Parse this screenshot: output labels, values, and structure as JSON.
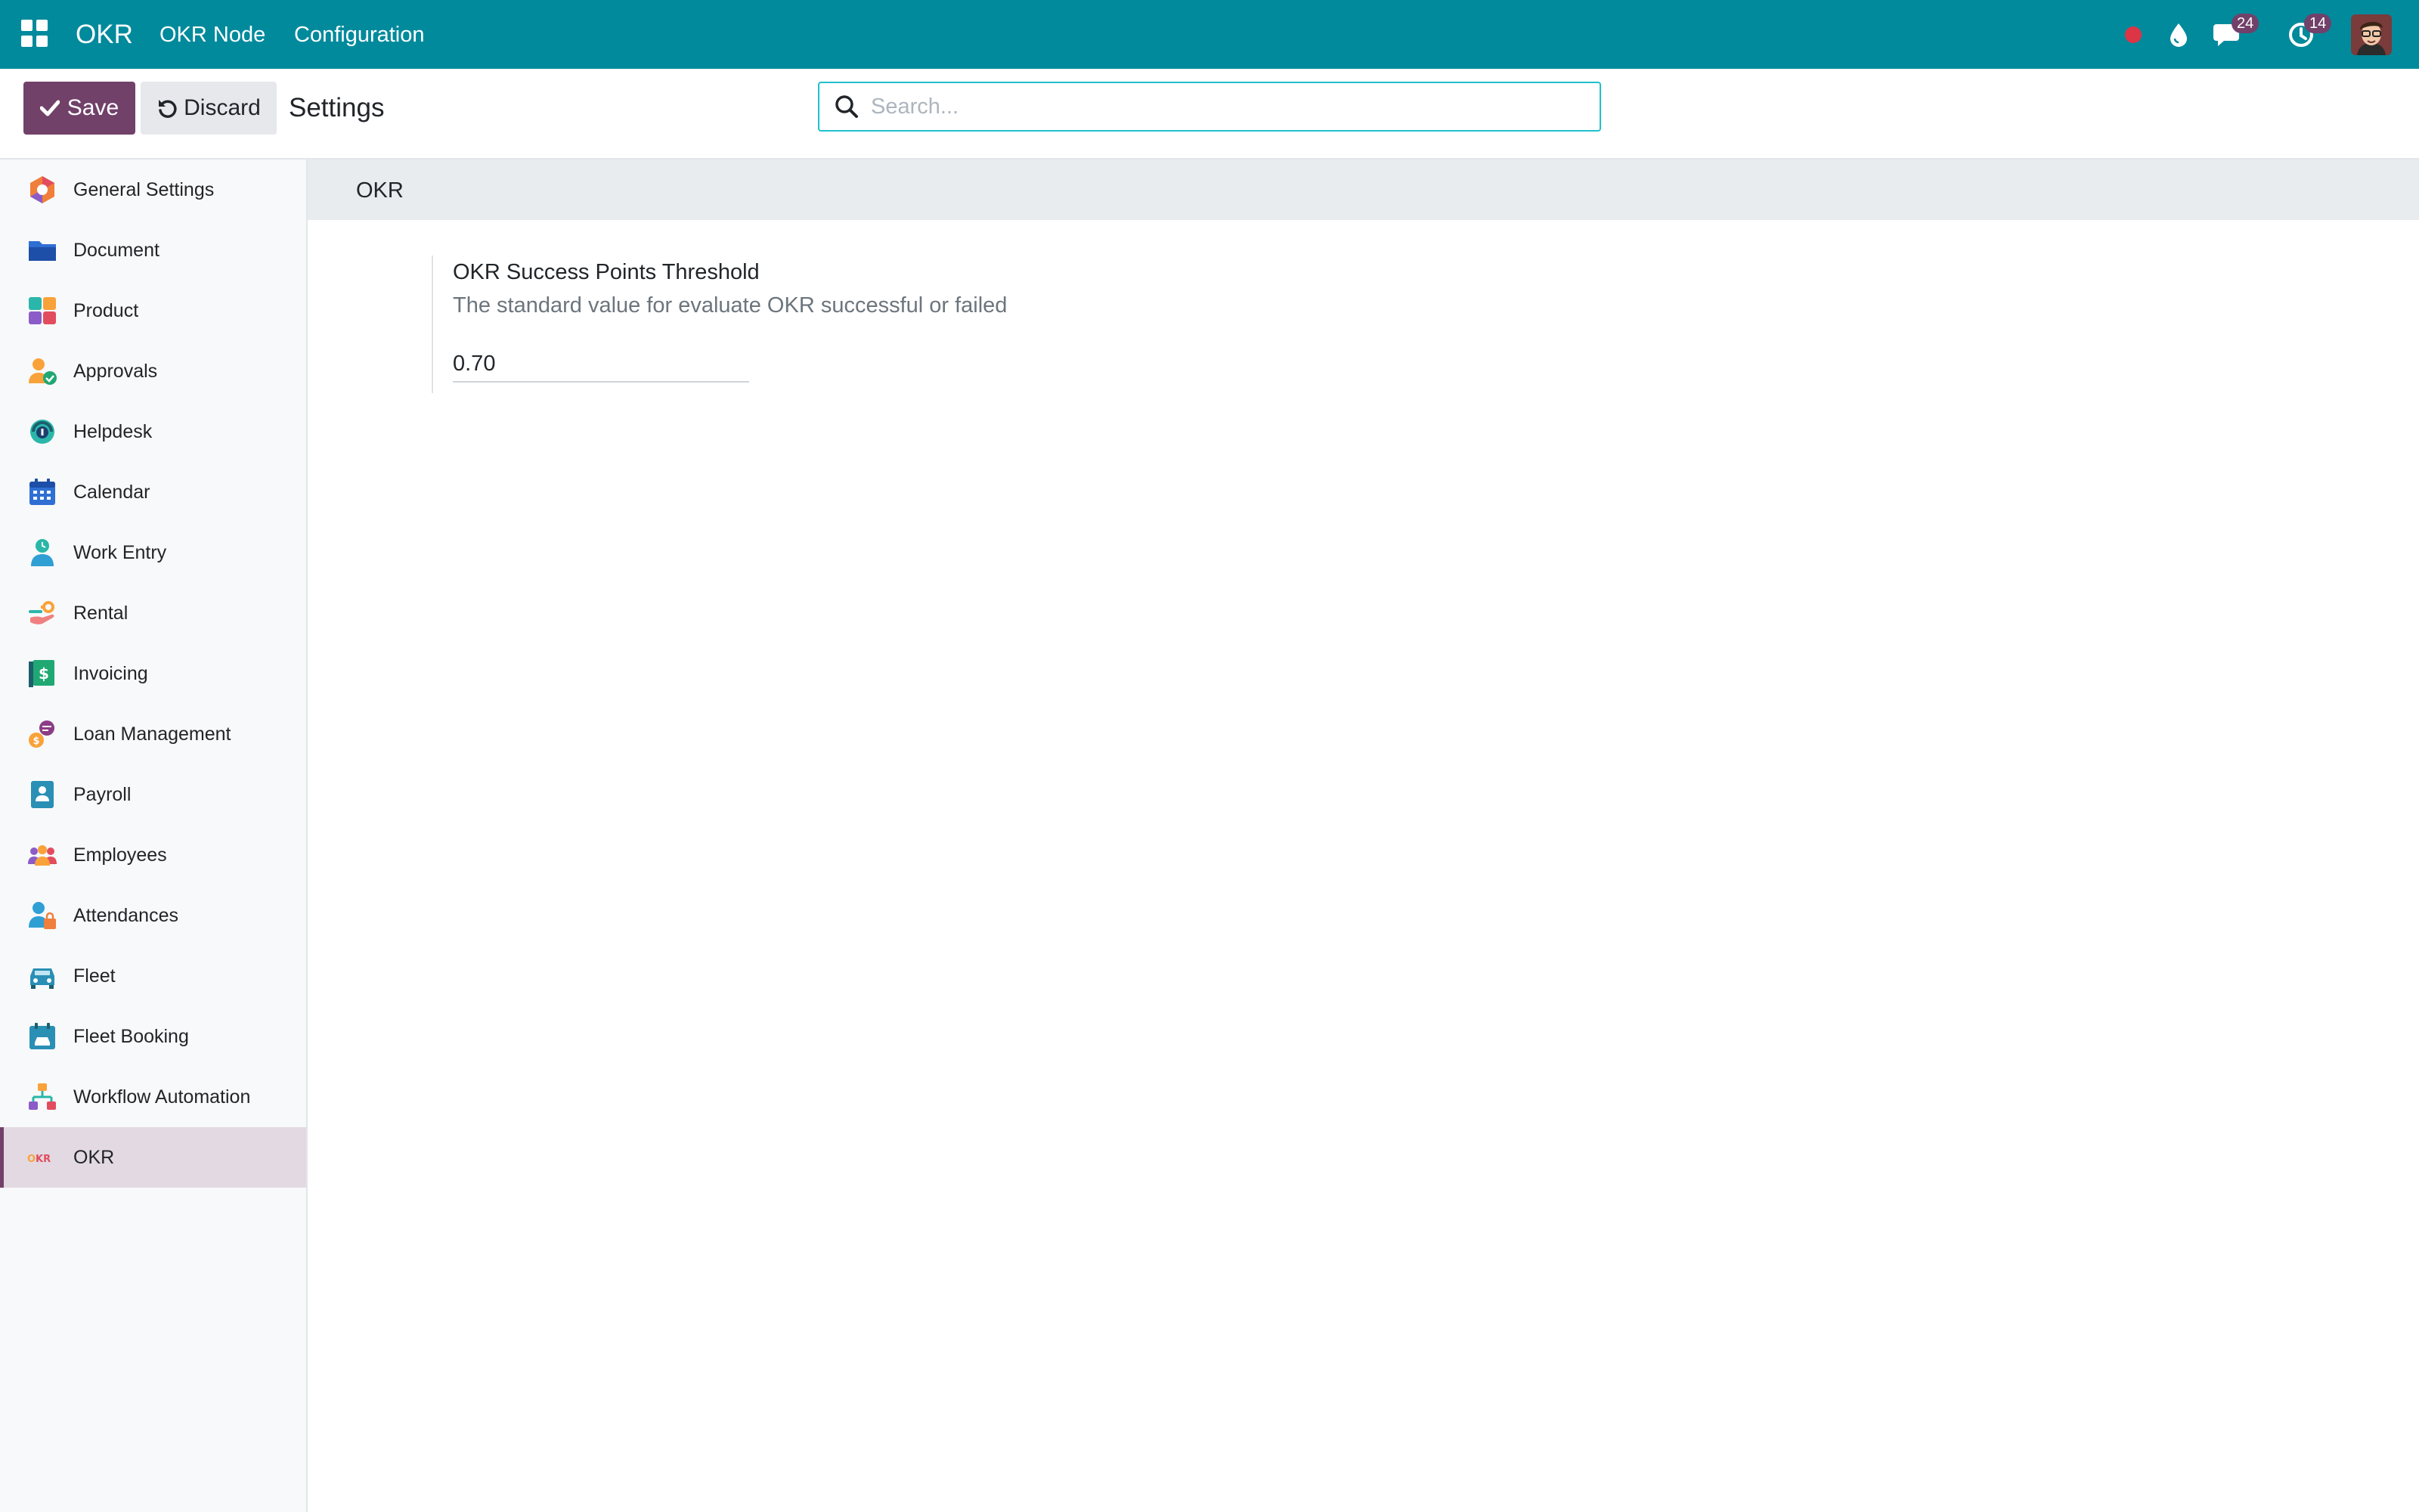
{
  "navbar": {
    "brand": "OKR",
    "menu": [
      "OKR Node",
      "Configuration"
    ],
    "messages_count": "24",
    "activities_count": "14"
  },
  "control_panel": {
    "save_label": "Save",
    "discard_label": "Discard",
    "title": "Settings",
    "search_placeholder": "Search..."
  },
  "sidebar": {
    "items": [
      {
        "label": "General Settings",
        "icon": "general-settings-icon"
      },
      {
        "label": "Document",
        "icon": "folder-icon"
      },
      {
        "label": "Product",
        "icon": "product-icon"
      },
      {
        "label": "Approvals",
        "icon": "approvals-icon"
      },
      {
        "label": "Helpdesk",
        "icon": "helpdesk-icon"
      },
      {
        "label": "Calendar",
        "icon": "calendar-icon"
      },
      {
        "label": "Work Entry",
        "icon": "work-entry-icon"
      },
      {
        "label": "Rental",
        "icon": "rental-icon"
      },
      {
        "label": "Invoicing",
        "icon": "invoice-icon"
      },
      {
        "label": "Loan Management",
        "icon": "loan-icon"
      },
      {
        "label": "Payroll",
        "icon": "payroll-icon"
      },
      {
        "label": "Employees",
        "icon": "employees-icon"
      },
      {
        "label": "Attendances",
        "icon": "attendances-icon"
      },
      {
        "label": "Fleet",
        "icon": "fleet-icon"
      },
      {
        "label": "Fleet Booking",
        "icon": "fleet-booking-icon"
      },
      {
        "label": "Workflow Automation",
        "icon": "workflow-icon"
      },
      {
        "label": "OKR",
        "icon": "okr-icon",
        "active": true
      }
    ]
  },
  "main": {
    "section_title": "OKR",
    "setting": {
      "label": "OKR Success Points Threshold",
      "help": "The standard value for evaluate OKR successful or failed",
      "value": "0.70"
    }
  },
  "colors": {
    "navbar": "#018a9c",
    "primary": "#71416a",
    "active_item_bg": "#e2d9e2",
    "record_dot": "#dc3545"
  },
  "okr_logo": {
    "o": "O",
    "kr": "KR"
  }
}
